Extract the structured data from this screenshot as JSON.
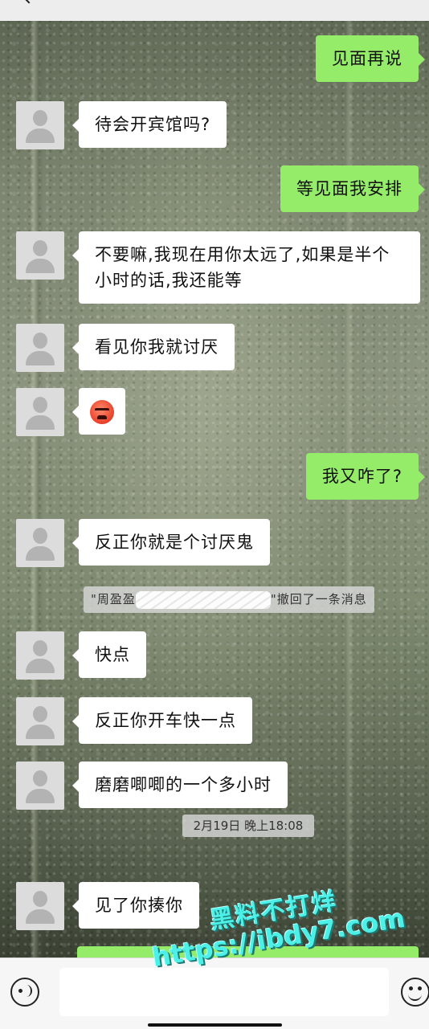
{
  "messages": {
    "m1": "见面再说",
    "m2": "待会开宾馆吗?",
    "m3": "等见面我安排",
    "m4": "不要嘛,我现在用你太远了,如果是半个小时的话,我还能等",
    "m5": "看见你我就讨厌",
    "m6": "angry-face-emoji",
    "m7": "我又咋了?",
    "m8": "反正你就是个讨厌鬼",
    "m9": "快点",
    "m10": "反正你开车快一点",
    "m11": "磨磨唧唧的一个多小时",
    "m12": "见了你揍你"
  },
  "recall_notice": {
    "name_prefix": "\"周盈盈",
    "suffix": "\"撤回了一条消息"
  },
  "timestamp": "2月19日 晚上18:08",
  "watermark": {
    "line1": "黑料不打烊",
    "line2": "https://ibdy7.com"
  },
  "input": {
    "placeholder": ""
  },
  "colors": {
    "outgoing_bubble": "#95ec69",
    "incoming_bubble": "#ffffff",
    "watermark": "#4df0e6"
  },
  "icons": {
    "back": "chevron-left-icon",
    "voice": "voice-input-icon",
    "emoji": "emoji-icon"
  }
}
